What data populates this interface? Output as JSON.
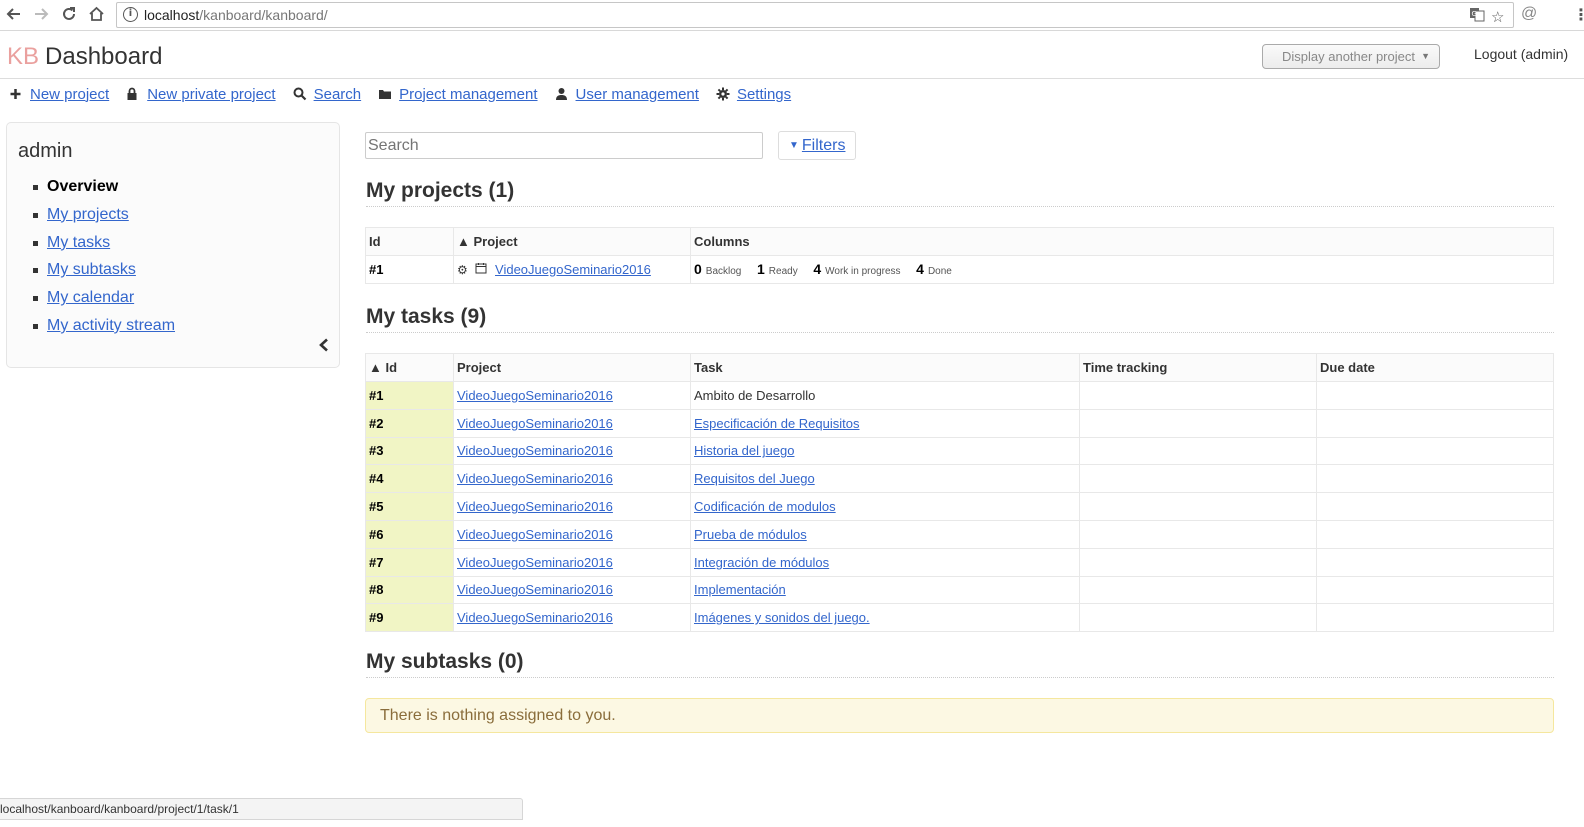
{
  "browser": {
    "url_host": "localhost",
    "url_path": "/kanboard/kanboard/"
  },
  "header": {
    "logo_kb": "KB",
    "title": "Dashboard",
    "project_select": "Display another project",
    "logout_label": "Logout",
    "logout_user": "(admin)"
  },
  "menu": {
    "new_project": "New project",
    "new_private_project": "New private project",
    "search": "Search",
    "project_management": "Project management",
    "user_management": "User management",
    "settings": "Settings"
  },
  "sidebar": {
    "title": "admin",
    "items": [
      {
        "label": "Overview"
      },
      {
        "label": "My projects"
      },
      {
        "label": "My tasks"
      },
      {
        "label": "My subtasks"
      },
      {
        "label": "My calendar"
      },
      {
        "label": "My activity stream"
      }
    ]
  },
  "search": {
    "placeholder": "Search",
    "filters_label": "Filters"
  },
  "projects": {
    "title": "My projects (1)",
    "headers": [
      "Id",
      "▲ Project",
      "Columns"
    ],
    "rows": [
      {
        "id": "#1",
        "name": "VideoJuegoSeminario2016",
        "columns": [
          {
            "count": "0",
            "name": "Backlog"
          },
          {
            "count": "1",
            "name": "Ready"
          },
          {
            "count": "4",
            "name": "Work in progress"
          },
          {
            "count": "4",
            "name": "Done"
          }
        ]
      }
    ]
  },
  "tasks": {
    "title": "My tasks (9)",
    "headers": [
      "▲ Id",
      "Project",
      "Task",
      "Time tracking",
      "Due date"
    ],
    "rows": [
      {
        "id": "#1",
        "project": "VideoJuegoSeminario2016",
        "task": "Ambito de Desarrollo",
        "task_link": false
      },
      {
        "id": "#2",
        "project": "VideoJuegoSeminario2016",
        "task": "Especificación de Requisitos",
        "task_link": true
      },
      {
        "id": "#3",
        "project": "VideoJuegoSeminario2016",
        "task": "Historia del juego",
        "task_link": true
      },
      {
        "id": "#4",
        "project": "VideoJuegoSeminario2016",
        "task": "Requisitos del Juego",
        "task_link": true
      },
      {
        "id": "#5",
        "project": "VideoJuegoSeminario2016",
        "task": "Codificación de modulos",
        "task_link": true
      },
      {
        "id": "#6",
        "project": "VideoJuegoSeminario2016",
        "task": "Prueba de módulos",
        "task_link": true
      },
      {
        "id": "#7",
        "project": "VideoJuegoSeminario2016",
        "task": "Integración de módulos",
        "task_link": true
      },
      {
        "id": "#8",
        "project": "VideoJuegoSeminario2016",
        "task": "Implementación",
        "task_link": true
      },
      {
        "id": "#9",
        "project": "VideoJuegoSeminario2016",
        "task": "Imágenes y sonidos del juego.",
        "task_link": true
      }
    ]
  },
  "subtasks": {
    "title": "My subtasks (0)",
    "empty_message": "There is nothing assigned to you."
  },
  "status_bar": {
    "text": "localhost/kanboard/kanboard/project/1/task/1"
  }
}
